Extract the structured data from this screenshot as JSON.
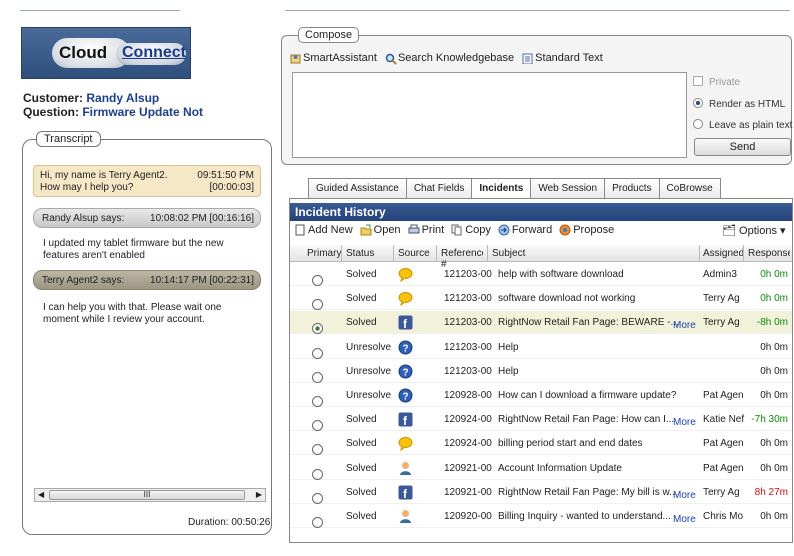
{
  "logo": {
    "word1": "Cloud",
    "word2": "Connect"
  },
  "customer": {
    "label": "Customer:",
    "name": "Randy Alsup",
    "question_label": "Question:",
    "question": "Firmware Update Not"
  },
  "transcript": {
    "label": "Transcript",
    "greeting": {
      "line1": "Hi, my name is Terry Agent2.",
      "line2": "How may I help you?",
      "time": "09:51:50 PM",
      "elapsed": "[00:00:03]"
    },
    "entries": [
      {
        "speaker": "Randy Alsup says:",
        "time": "10:08:02 PM [00:16:16]",
        "text": "I updated my tablet firmware but the new features aren't enabled"
      },
      {
        "speaker": "Terry Agent2 says:",
        "time": "10:14:17 PM [00:22:31]",
        "text": "I can help you with that.  Please wait one moment while I review your account."
      }
    ],
    "scroll_thumb": "III",
    "duration": "Duration: 00:50:26"
  },
  "compose": {
    "label": "Compose",
    "tools": [
      "SmartAssistant",
      "Search Knowledgebase",
      "Standard Text"
    ],
    "private": "Private",
    "render_html": "Render as HTML",
    "plain_text": "Leave as plain text",
    "send": "Send"
  },
  "tabs": [
    "Guided Assistance",
    "Chat Fields",
    "Incidents",
    "Web Session",
    "Products",
    "CoBrowse"
  ],
  "incidents": {
    "title": "Incident History",
    "toolbar": [
      "Add New",
      "Open",
      "Print",
      "Copy",
      "Forward",
      "Propose"
    ],
    "options": "Options",
    "columns": [
      "Primary",
      "Status",
      "Source",
      "Reference #",
      "Subject",
      "Assigned",
      "Response"
    ],
    "rows": [
      {
        "status": "Solved",
        "source": "chat",
        "ref": "121203-00",
        "subject": "help with software download",
        "more": "",
        "assigned": "Admin3",
        "resp": "0h 0m",
        "resp_color": "#0a8a0a"
      },
      {
        "status": "Solved",
        "source": "chat",
        "ref": "121203-00",
        "subject": "software download not working",
        "more": "",
        "assigned": "Terry Ag",
        "resp": "0h 0m",
        "resp_color": "#0a8a0a"
      },
      {
        "status": "Solved",
        "source": "facebook",
        "ref": "121203-00",
        "subject": "RightNow Retail Fan Page: BEWARE -...",
        "more": "More",
        "assigned": "Terry Ag",
        "resp": "-8h 0m",
        "resp_color": "#0a8a0a",
        "selected": true
      },
      {
        "status": "Unresolve",
        "source": "question",
        "ref": "121203-00",
        "subject": "Help",
        "more": "",
        "assigned": "",
        "resp": "0h 0m",
        "resp_color": "#222"
      },
      {
        "status": "Unresolve",
        "source": "question",
        "ref": "121203-00",
        "subject": "Help",
        "more": "",
        "assigned": "",
        "resp": "0h 0m",
        "resp_color": "#222"
      },
      {
        "status": "Unresolve",
        "source": "question",
        "ref": "120928-00",
        "subject": "How can I download a firmware update?",
        "more": "",
        "assigned": "Pat Agen",
        "resp": "0h 0m",
        "resp_color": "#222"
      },
      {
        "status": "Solved",
        "source": "facebook",
        "ref": "120924-00",
        "subject": "RightNow Retail Fan Page: How can I...",
        "more": "More",
        "assigned": "Katie Nef",
        "resp": "-7h 30m",
        "resp_color": "#0a8a0a"
      },
      {
        "status": "Solved",
        "source": "chat",
        "ref": "120924-00",
        "subject": "billing period start and end dates",
        "more": "",
        "assigned": "Pat Agen",
        "resp": "0h 0m",
        "resp_color": "#222"
      },
      {
        "status": "Solved",
        "source": "person",
        "ref": "120921-00",
        "subject": "Account Information Update",
        "more": "",
        "assigned": "Pat Agen",
        "resp": "0h 0m",
        "resp_color": "#222"
      },
      {
        "status": "Solved",
        "source": "facebook",
        "ref": "120921-00",
        "subject": "RightNow Retail Fan Page: My bill is w...",
        "more": "More",
        "assigned": "Terry Ag",
        "resp": "8h 27m",
        "resp_color": "#d01010"
      },
      {
        "status": "Solved",
        "source": "person",
        "ref": "120920-00",
        "subject": "Billing Inquiry - wanted to understand...",
        "more": "More",
        "assigned": "Chris Mo",
        "resp": "0h 0m",
        "resp_color": "#222"
      }
    ]
  }
}
